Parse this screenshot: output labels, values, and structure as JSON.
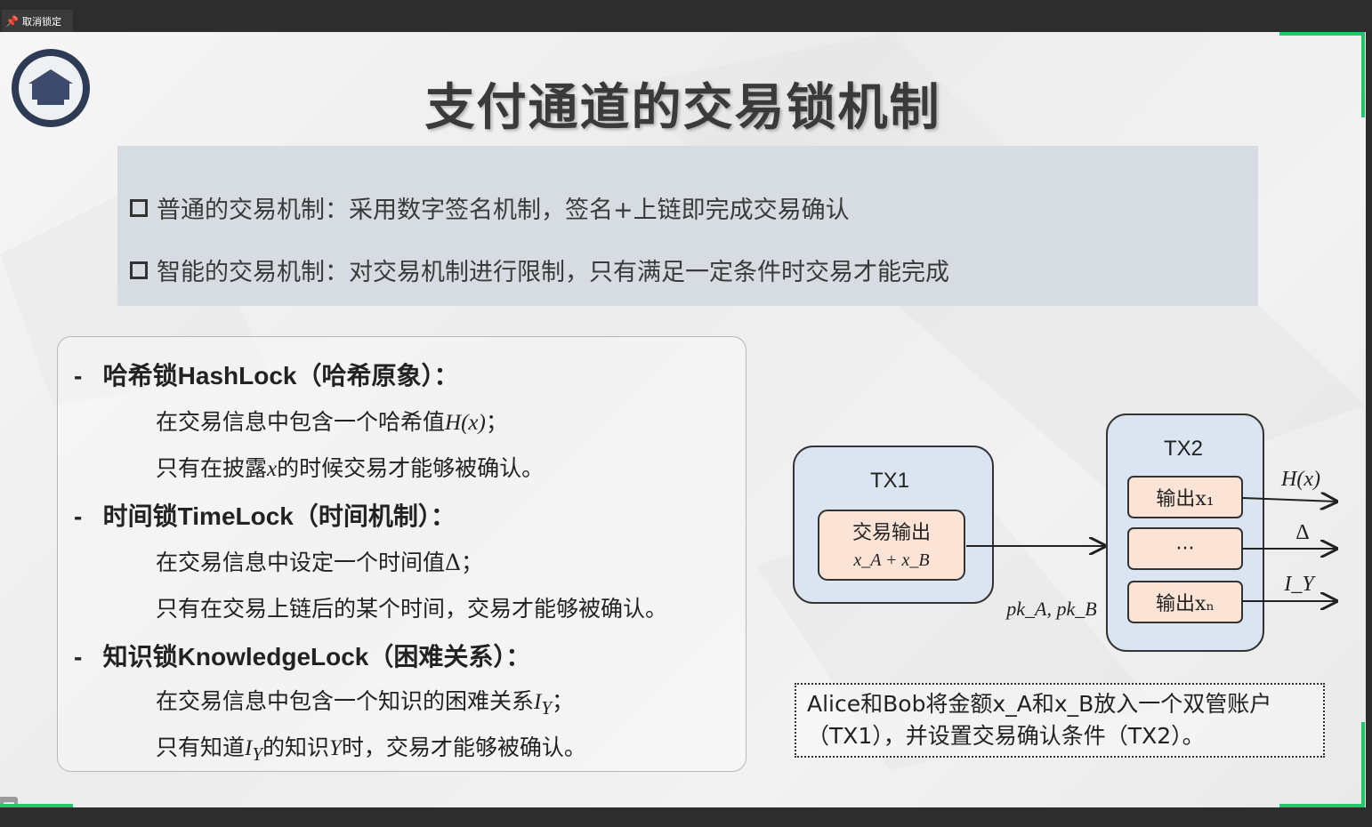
{
  "topbar": {
    "unlock_label": "取消锁定"
  },
  "slide": {
    "title": "支付通道的交易锁机制",
    "summary": [
      "普通的交易机制：采用数字签名机制，签名+上链即完成交易确认",
      "智能的交易机制：对交易机制进行限制，只有满足一定条件时交易才能完成"
    ],
    "locks": {
      "hash": {
        "head": "哈希锁HashLock（哈希原象）：",
        "line1_pre": "在交易信息中包含一个哈希值",
        "line1_math": "H(x)",
        "line1_post": "；",
        "line2_pre": "只有在披露",
        "line2_math": "x",
        "line2_post": "的时候交易才能够被确认。"
      },
      "time": {
        "head": "时间锁TimeLock（时间机制）：",
        "line1": "在交易信息中设定一个时间值Δ；",
        "line2": "只有在交易上链后的某个时间，交易才能够被确认。"
      },
      "knowledge": {
        "head": "知识锁KnowledgeLock（困难关系）：",
        "line1_pre": "在交易信息中包含一个知识的困难关系",
        "line1_math": "I",
        "line1_sub": "Y",
        "line1_post": "；",
        "line2_pre": "只有知道",
        "line2_math": "I",
        "line2_sub": "Y",
        "line2_mid": "的知识",
        "line2_math2": "Y",
        "line2_post": "时，交易才能够被确认。"
      }
    },
    "diagram": {
      "tx1": "TX1",
      "tx1_inner_line1": "交易输出",
      "tx1_inner_line2": "x_A + x_B",
      "tx2": "TX2",
      "out1": "输出x₁",
      "out_dots": "···",
      "outn": "输出xₙ",
      "arrow_label": "pk_A, pk_B",
      "cond1": "H(x)",
      "cond2": "Δ",
      "cond3": "I_Y"
    },
    "note_line1": "Alice和Bob将金额x_A和x_B放入一个双管账户",
    "note_line2": "（TX1），并设置交易确认条件（TX2）。"
  },
  "colors": {
    "accent_green": "#1fc66a",
    "box_fill": "#dbe5f1",
    "output_fill": "#fbe4d5"
  }
}
